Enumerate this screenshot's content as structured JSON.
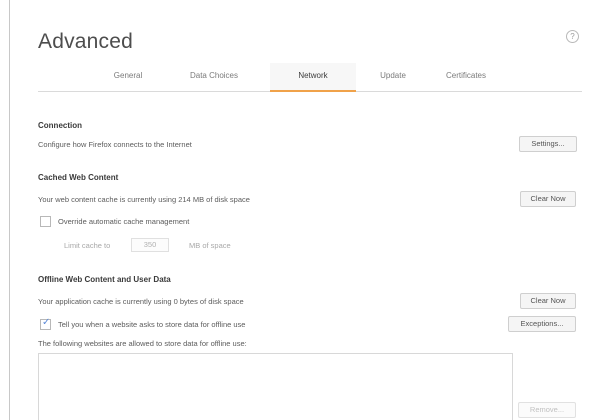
{
  "page": {
    "title": "Advanced",
    "help_icon": "question-circle-icon",
    "accent_color": "#f0a24a"
  },
  "tabs": [
    {
      "label": "General",
      "active": false
    },
    {
      "label": "Data Choices",
      "active": false
    },
    {
      "label": "Network",
      "active": true
    },
    {
      "label": "Update",
      "active": false
    },
    {
      "label": "Certificates",
      "active": false
    }
  ],
  "connection": {
    "title": "Connection",
    "description": "Configure how Firefox connects to the Internet",
    "button": "Settings..."
  },
  "cached": {
    "title": "Cached Web Content",
    "description": "Your web content cache is currently using 214 MB of disk space",
    "button": "Clear Now",
    "override_label": "Override automatic cache management",
    "override_checked": false,
    "limit_label": "Limit cache to",
    "limit_value": "350",
    "limit_unit": "MB of space"
  },
  "offline": {
    "title": "Offline Web Content and User Data",
    "description": "Your application cache is currently using 0 bytes of disk space",
    "clear_button": "Clear Now",
    "tell_label": "Tell you when a website asks to store data for offline use",
    "tell_checked": true,
    "exceptions_button": "Exceptions...",
    "allowed_label": "The following websites are allowed to store data for offline use:",
    "remove_button": "Remove..."
  }
}
